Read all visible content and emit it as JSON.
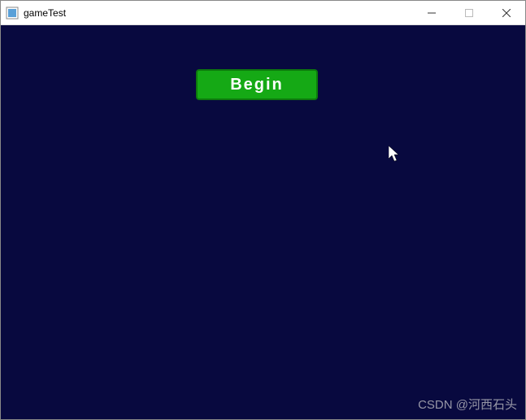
{
  "window": {
    "title": "gameTest"
  },
  "main": {
    "begin_label": "Begin"
  },
  "watermark": {
    "text": "CSDN @河西石头"
  }
}
